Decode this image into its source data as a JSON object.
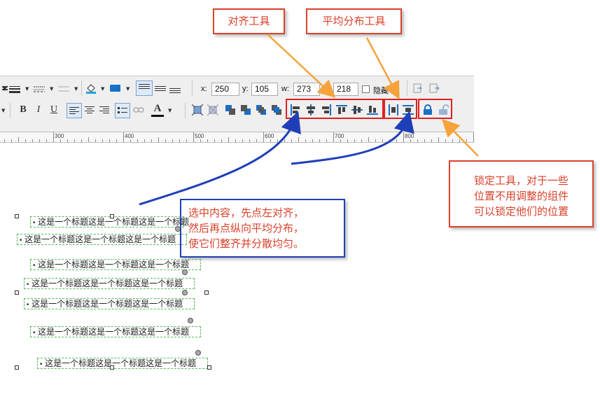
{
  "callouts": {
    "align_tool": "对齐工具",
    "distribute_tool": "平均分布工具",
    "lock_tool": [
      "锁定工具，对于一些",
      "位置不用调整的组件",
      "可以锁定他们的位置"
    ],
    "instruction": [
      "选中内容，先点左对齐，",
      "然后再点纵向平均分布，",
      "使它们整齐并分散均匀。"
    ]
  },
  "toolbar": {
    "x_label": "x:",
    "x_value": "250",
    "y_label": "y:",
    "y_value": "105",
    "w_label": "w:",
    "w_value": "273",
    "h_label": "h:",
    "h_value": "218",
    "hidden_label": "隐藏",
    "bold": "B",
    "italic": "I",
    "underline": "U",
    "font_color": "A"
  },
  "ruler": {
    "labels": [
      "300",
      "400",
      "500",
      "600",
      "700",
      "800"
    ]
  },
  "canvas": {
    "items": [
      {
        "text": "这是一个标题这是一个标题这是一个标题"
      },
      {
        "text": "这是一个标题这是一个标题这是一个标题"
      },
      {
        "text": "这是一个标题这是一个标题这是一个标题"
      },
      {
        "text": "这是一个标题这是一个标题这是一个标题"
      },
      {
        "text": "这是一个标题这是一个标题这是一个标题"
      },
      {
        "text": "这是一个标题这是一个标题这是一个标题"
      },
      {
        "text": "这是一个标题这是一个标题这是一个标题"
      }
    ]
  },
  "colors": {
    "callout_red": "#d9412a",
    "arrow_orange": "#f5a33a",
    "arrow_blue": "#1f3fb8",
    "highlight": "#e02020",
    "item_border": "#59b959"
  }
}
